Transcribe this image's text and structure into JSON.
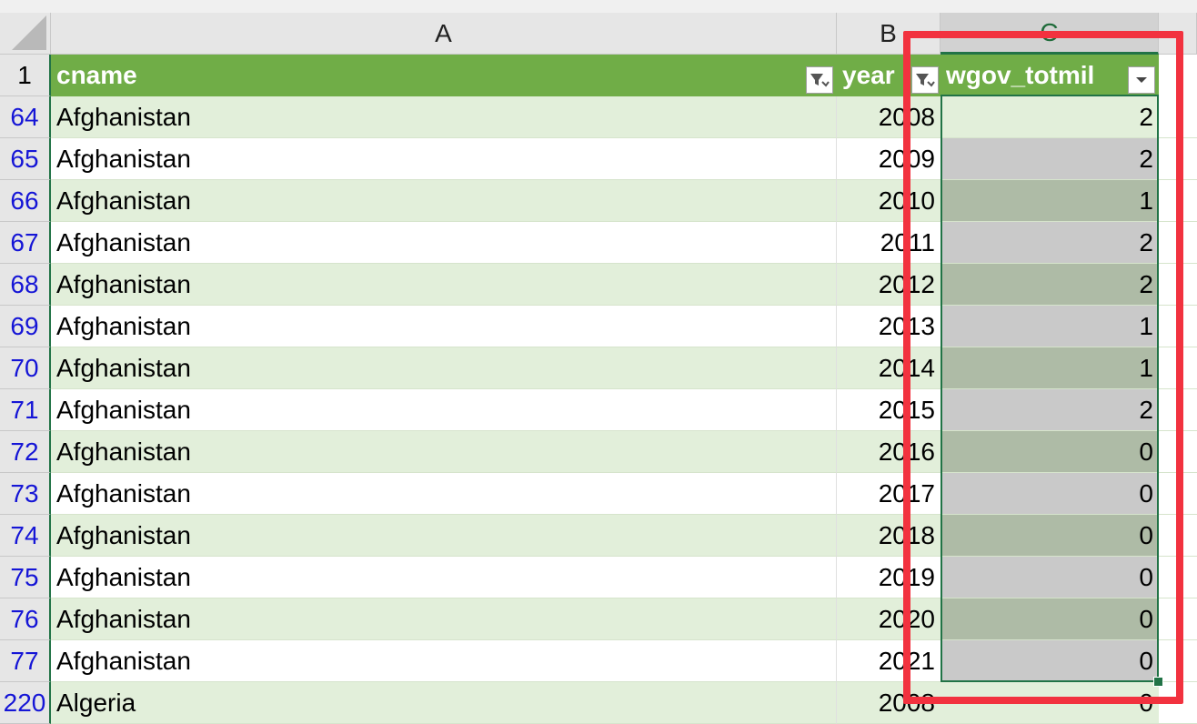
{
  "columns": [
    {
      "letter": "A",
      "header": "cname"
    },
    {
      "letter": "B",
      "header": "year"
    },
    {
      "letter": "C",
      "header": "wgov_totmil"
    }
  ],
  "header_row_number": "1",
  "rows": [
    {
      "rownum": "64",
      "cname": "Afghanistan",
      "year": "2008",
      "value": "2"
    },
    {
      "rownum": "65",
      "cname": "Afghanistan",
      "year": "2009",
      "value": "2"
    },
    {
      "rownum": "66",
      "cname": "Afghanistan",
      "year": "2010",
      "value": "1"
    },
    {
      "rownum": "67",
      "cname": "Afghanistan",
      "year": "2011",
      "value": "2"
    },
    {
      "rownum": "68",
      "cname": "Afghanistan",
      "year": "2012",
      "value": "2"
    },
    {
      "rownum": "69",
      "cname": "Afghanistan",
      "year": "2013",
      "value": "1"
    },
    {
      "rownum": "70",
      "cname": "Afghanistan",
      "year": "2014",
      "value": "1"
    },
    {
      "rownum": "71",
      "cname": "Afghanistan",
      "year": "2015",
      "value": "2"
    },
    {
      "rownum": "72",
      "cname": "Afghanistan",
      "year": "2016",
      "value": "0"
    },
    {
      "rownum": "73",
      "cname": "Afghanistan",
      "year": "2017",
      "value": "0"
    },
    {
      "rownum": "74",
      "cname": "Afghanistan",
      "year": "2018",
      "value": "0"
    },
    {
      "rownum": "75",
      "cname": "Afghanistan",
      "year": "2019",
      "value": "0"
    },
    {
      "rownum": "76",
      "cname": "Afghanistan",
      "year": "2020",
      "value": "0"
    },
    {
      "rownum": "77",
      "cname": "Afghanistan",
      "year": "2021",
      "value": "0"
    },
    {
      "rownum": "220",
      "cname": "Algeria",
      "year": "2008",
      "value": "0"
    }
  ],
  "colors": {
    "table_header": "#70ad47",
    "band": "#e2efda",
    "selection": "#217346",
    "annotation": "#f2323f",
    "filtered_row_number": "#1515d6"
  },
  "icons": {
    "filter_active": "filter-funnel-icon",
    "dropdown": "dropdown-arrow-icon"
  }
}
